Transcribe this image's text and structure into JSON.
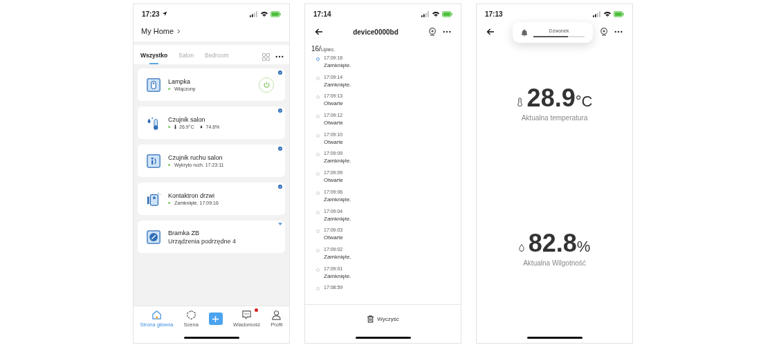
{
  "home_screen": {
    "status_bar": {
      "time": "17:23",
      "location": true
    },
    "header": {
      "title": "My Home"
    },
    "tabs": [
      {
        "label": "Wszystko",
        "selected": true
      },
      {
        "label": "Salon",
        "selected": false
      },
      {
        "label": "Bedroom",
        "selected": false
      }
    ],
    "devices": [
      {
        "kind": "switch",
        "name": "Lampka",
        "status": "Włączony",
        "on": true
      },
      {
        "kind": "climate",
        "name": "Czujnik salon",
        "temperature": "26.9°C",
        "humidity": "74.6%"
      },
      {
        "kind": "motion",
        "name": "Czujnik ruchu salon",
        "status": "Wykryto ruch. 17:23:11"
      },
      {
        "kind": "contact",
        "name": "Kontaktron drzwi",
        "status": "Zamknięte. 17:09:16"
      },
      {
        "kind": "gateway",
        "name": "Bramka ZB",
        "status": "Urządzenia podrzędne 4"
      }
    ],
    "nav": [
      {
        "kind": "home",
        "label": "Strona główna",
        "selected": true,
        "unread": false
      },
      {
        "kind": "scene",
        "label": "Scena",
        "selected": false,
        "unread": false
      },
      {
        "kind": "add"
      },
      {
        "kind": "messages",
        "label": "Wiadomość",
        "selected": false,
        "unread": true
      },
      {
        "kind": "profile",
        "label": "Profil",
        "selected": false,
        "unread": false
      }
    ]
  },
  "log_screen": {
    "status_bar": {
      "time": "17:14"
    },
    "title": "device0000bd",
    "day": "16/",
    "month": "Lipiec.",
    "entries": [
      {
        "time": "17:09:16",
        "state": "Zamknięte.",
        "selected": true
      },
      {
        "time": "17:09:14",
        "state": "Zamknięte.",
        "selected": false
      },
      {
        "time": "17:09:13",
        "state": "Otwarte",
        "selected": false
      },
      {
        "time": "17:09:12",
        "state": "Otwarte",
        "selected": false
      },
      {
        "time": "17:09:10",
        "state": "Otwarte",
        "selected": false
      },
      {
        "time": "17:09:09",
        "state": "Zamknięte.",
        "selected": false
      },
      {
        "time": "17:09:09",
        "state": "Otwarte",
        "selected": false
      },
      {
        "time": "17:09:06",
        "state": "Zamknięte.",
        "selected": false
      },
      {
        "time": "17:09:04",
        "state": "Zamknięte.",
        "selected": false
      },
      {
        "time": "17:09:03",
        "state": "Otwarte",
        "selected": false
      },
      {
        "time": "17:09:02",
        "state": "Zamknięte.",
        "selected": false
      },
      {
        "time": "17:09:01",
        "state": "Zamknięte.",
        "selected": false
      },
      {
        "time": "17:08:59",
        "selected": false
      }
    ],
    "clear_button": "Wyczyść"
  },
  "sensor_screen": {
    "status_bar": {
      "time": "17:13"
    },
    "volume_popup": {
      "label": "Dzwonek",
      "level": 0.67
    },
    "readings": [
      {
        "kind": "temperature",
        "value": "28.9",
        "unit": "°C",
        "label": "Aktualna temperatura"
      },
      {
        "kind": "humidity",
        "value": "82.8",
        "unit": "%",
        "label": "Aktualna Wilgotność"
      }
    ]
  }
}
